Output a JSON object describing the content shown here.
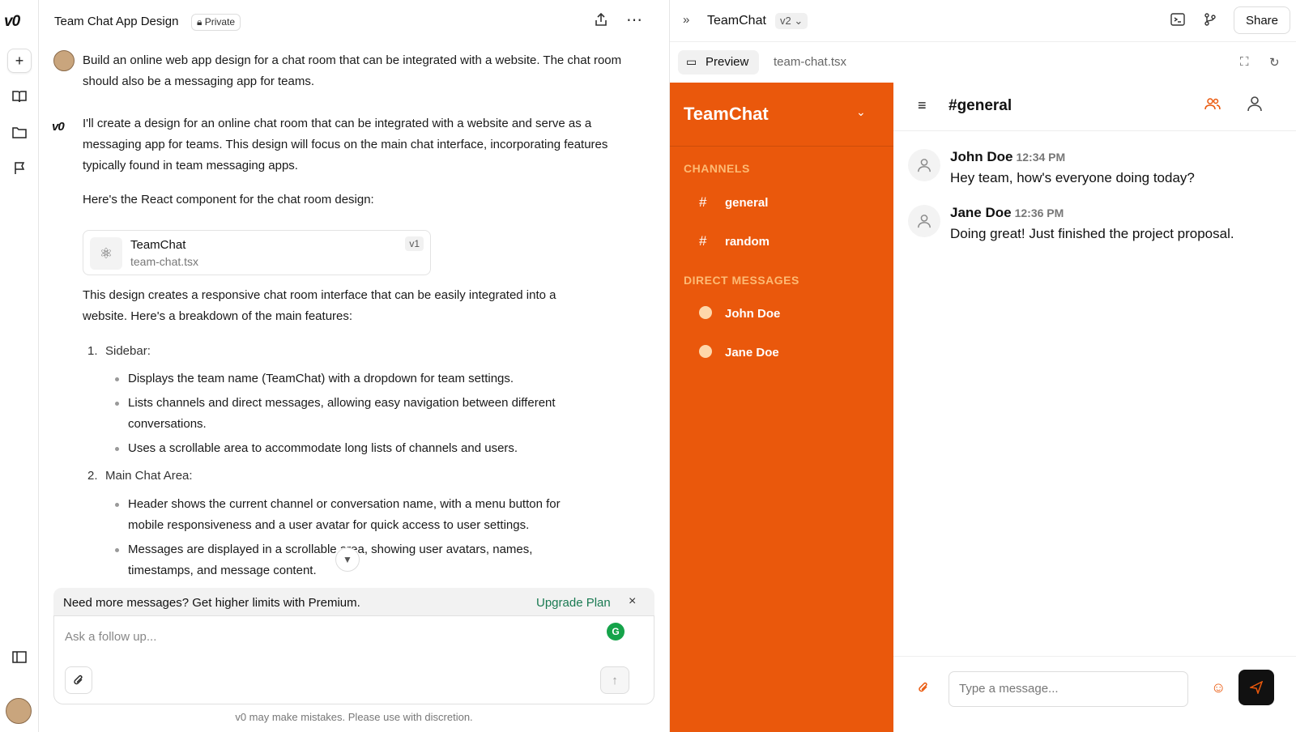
{
  "rail": {
    "logo": "v0"
  },
  "header": {
    "title": "Team Chat App Design",
    "privacy": "Private"
  },
  "messages": {
    "user_prompt": "Build an online web app design for a chat room that can be integrated with a website. The chat room should also be a messaging app for teams.",
    "reply_intro": "I'll create a design for an online chat room that can be integrated with a website and serve as a messaging app for teams. This design will focus on the main chat interface, incorporating features typically found in team messaging apps.",
    "reply_lead": "Here's the React component for the chat room design:",
    "artifact": {
      "name": "TeamChat",
      "file": "team-chat.tsx",
      "version": "v1"
    },
    "reply_summary": "This design creates a responsive chat room interface that can be easily integrated into a website. Here's a breakdown of the main features:",
    "sections": [
      {
        "number": "1.",
        "title": "Sidebar:",
        "bullets": [
          "Displays the team name (TeamChat) with a dropdown for team settings.",
          "Lists channels and direct messages, allowing easy navigation between different conversations.",
          "Uses a scrollable area to accommodate long lists of channels and users."
        ]
      },
      {
        "number": "2.",
        "title": "Main Chat Area:",
        "bullets": [
          "Header shows the current channel or conversation name, with a menu button for mobile responsiveness and a user avatar for quick access to user settings.",
          "Messages are displayed in a scrollable area, showing user avatars, names, timestamps, and message content."
        ]
      }
    ]
  },
  "banner": {
    "text": "Need more messages? Get higher limits with Premium.",
    "upgrade": "Upgrade Plan",
    "close": "×"
  },
  "composer": {
    "placeholder": "Ask a follow up..."
  },
  "disclaimer": "v0 may make mistakes. Please use with discretion.",
  "preview": {
    "name": "TeamChat",
    "version": "v2",
    "share": "Share",
    "tabs": {
      "preview": "Preview",
      "file": "team-chat.tsx"
    },
    "app": {
      "brand": "TeamChat",
      "channels_heading": "CHANNELS",
      "channels": [
        "general",
        "random"
      ],
      "dm_heading": "DIRECT MESSAGES",
      "dms": [
        "John Doe",
        "Jane Doe"
      ],
      "current_channel": "#general",
      "messages": [
        {
          "name": "John Doe",
          "time": "12:34 PM",
          "text": "Hey team, how's everyone doing today?"
        },
        {
          "name": "Jane Doe",
          "time": "12:36 PM",
          "text": "Doing great! Just finished the project proposal."
        }
      ],
      "input_placeholder": "Type a message..."
    }
  },
  "colors": {
    "accent": "#ea580c",
    "upgrade": "#1a7a52"
  }
}
